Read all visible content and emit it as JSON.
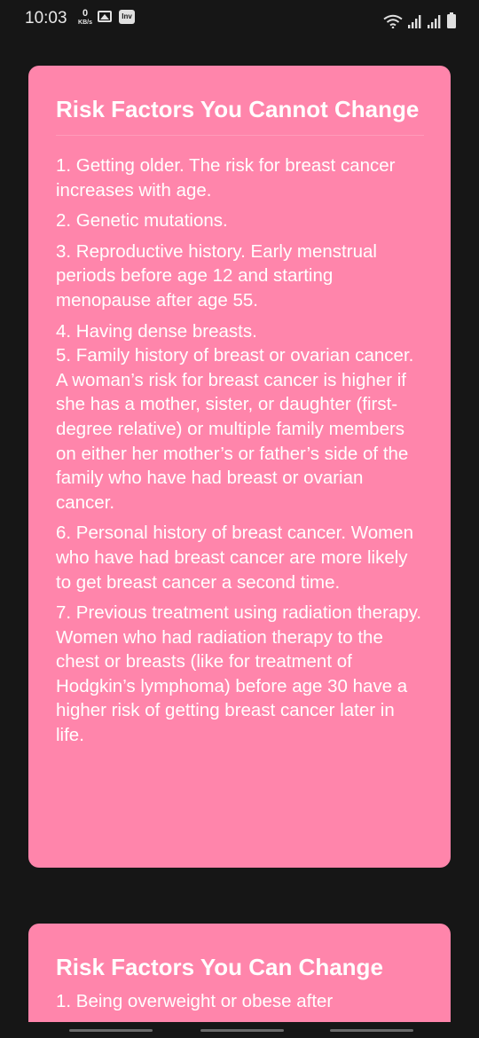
{
  "status_bar": {
    "time": "10:03",
    "network_speed_value": "0",
    "network_speed_unit": "KB/s",
    "inv_badge": "Inv",
    "icons": [
      "gallery-icon",
      "wifi-icon",
      "signal-icon",
      "signal-icon",
      "battery-icon"
    ]
  },
  "cards": [
    {
      "title": "Risk Factors You Cannot Change",
      "items": [
        "1. Getting older. The risk for breast cancer increases with age.",
        "2. Genetic mutations.",
        "3. Reproductive history. Early menstrual periods before age 12 and starting menopause after age 55.",
        "4. Having dense breasts.",
        "5. Family history of breast or ovarian cancer. A woman’s risk for breast cancer is higher if she has a mother, sister, or daughter (first-degree relative) or multiple family members on either her mother’s or father’s side of the family who have had breast or ovarian cancer.",
        "6. Personal history of breast cancer. Women who have had breast cancer are more likely to get breast cancer a second time.",
        "7. Previous treatment using radiation therapy. Women who had radiation therapy to the chest or breasts (like for treatment of Hodgkin’s lymphoma) before age 30 have a higher risk of getting breast cancer later in life."
      ]
    },
    {
      "title": "Risk Factors You Can Change",
      "items": [
        "1. Being overweight or obese after"
      ]
    }
  ],
  "colors": {
    "background": "#161616",
    "card": "#ff85ab",
    "text": "#ffffff"
  }
}
